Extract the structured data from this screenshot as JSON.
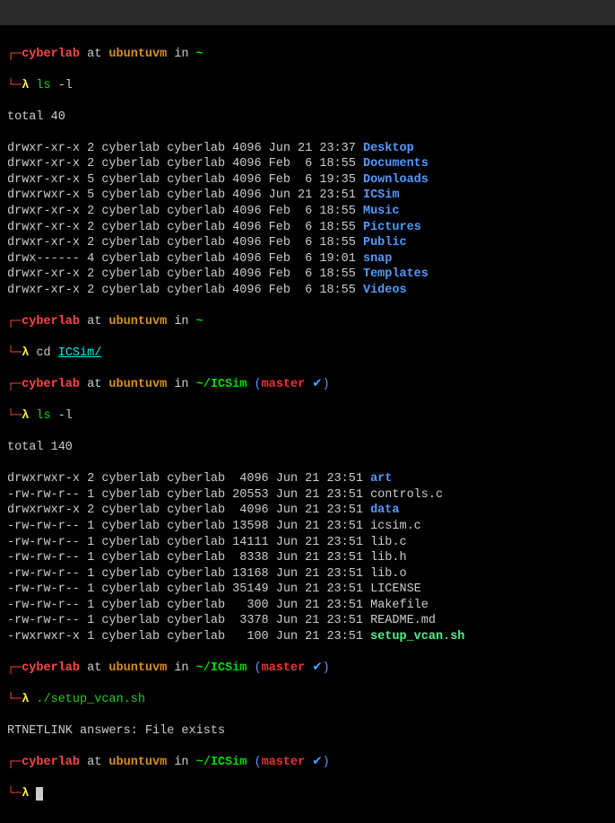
{
  "prompt": {
    "user": "cyberlab",
    "at": " at ",
    "host": "ubuntuvm",
    "in": " in ",
    "home": "~",
    "subpath": "~/ICSim",
    "branch_open": " (",
    "branch": "master",
    "check": " ✔",
    "branch_close": ")",
    "corner_top": "┌─",
    "corner_bot": "└─",
    "lambda": "λ "
  },
  "cmds": {
    "ls": "ls",
    "ls_arg": " -l",
    "cd": "cd ",
    "cd_target": "ICSim/",
    "setup": "./setup_vcan.sh"
  },
  "ls1": {
    "total": "total 40",
    "rows": [
      {
        "perm": "drwxr-xr-x 2 cyberlab cyberlab 4096 Jun 21 23:37 ",
        "name": "Desktop",
        "cls": "dir"
      },
      {
        "perm": "drwxr-xr-x 2 cyberlab cyberlab 4096 Feb  6 18:55 ",
        "name": "Documents",
        "cls": "dir"
      },
      {
        "perm": "drwxr-xr-x 5 cyberlab cyberlab 4096 Feb  6 19:35 ",
        "name": "Downloads",
        "cls": "dir"
      },
      {
        "perm": "drwxrwxr-x 5 cyberlab cyberlab 4096 Jun 21 23:51 ",
        "name": "ICSim",
        "cls": "dir"
      },
      {
        "perm": "drwxr-xr-x 2 cyberlab cyberlab 4096 Feb  6 18:55 ",
        "name": "Music",
        "cls": "dir"
      },
      {
        "perm": "drwxr-xr-x 2 cyberlab cyberlab 4096 Feb  6 18:55 ",
        "name": "Pictures",
        "cls": "dir"
      },
      {
        "perm": "drwxr-xr-x 2 cyberlab cyberlab 4096 Feb  6 18:55 ",
        "name": "Public",
        "cls": "dir"
      },
      {
        "perm": "drwx------ 4 cyberlab cyberlab 4096 Feb  6 19:01 ",
        "name": "snap",
        "cls": "dir"
      },
      {
        "perm": "drwxr-xr-x 2 cyberlab cyberlab 4096 Feb  6 18:55 ",
        "name": "Templates",
        "cls": "dir"
      },
      {
        "perm": "drwxr-xr-x 2 cyberlab cyberlab 4096 Feb  6 18:55 ",
        "name": "Videos",
        "cls": "dir"
      }
    ]
  },
  "ls2": {
    "total": "total 140",
    "rows": [
      {
        "perm": "drwxrwxr-x 2 cyberlab cyberlab  4096 Jun 21 23:51 ",
        "name": "art",
        "cls": "dir"
      },
      {
        "perm": "-rw-rw-r-- 1 cyberlab cyberlab 20553 Jun 21 23:51 ",
        "name": "controls.c",
        "cls": "output"
      },
      {
        "perm": "drwxrwxr-x 2 cyberlab cyberlab  4096 Jun 21 23:51 ",
        "name": "data",
        "cls": "dir"
      },
      {
        "perm": "-rw-rw-r-- 1 cyberlab cyberlab 13598 Jun 21 23:51 ",
        "name": "icsim.c",
        "cls": "output"
      },
      {
        "perm": "-rw-rw-r-- 1 cyberlab cyberlab 14111 Jun 21 23:51 ",
        "name": "lib.c",
        "cls": "output"
      },
      {
        "perm": "-rw-rw-r-- 1 cyberlab cyberlab  8338 Jun 21 23:51 ",
        "name": "lib.h",
        "cls": "output"
      },
      {
        "perm": "-rw-rw-r-- 1 cyberlab cyberlab 13168 Jun 21 23:51 ",
        "name": "lib.o",
        "cls": "output"
      },
      {
        "perm": "-rw-rw-r-- 1 cyberlab cyberlab 35149 Jun 21 23:51 ",
        "name": "LICENSE",
        "cls": "output"
      },
      {
        "perm": "-rw-rw-r-- 1 cyberlab cyberlab   300 Jun 21 23:51 ",
        "name": "Makefile",
        "cls": "output"
      },
      {
        "perm": "-rw-rw-r-- 1 cyberlab cyberlab  3378 Jun 21 23:51 ",
        "name": "README.md",
        "cls": "output"
      },
      {
        "perm": "-rwxrwxr-x 1 cyberlab cyberlab   100 Jun 21 23:51 ",
        "name": "setup_vcan.sh",
        "cls": "exec-green"
      }
    ]
  },
  "rtnetlink": "RTNETLINK answers: File exists"
}
